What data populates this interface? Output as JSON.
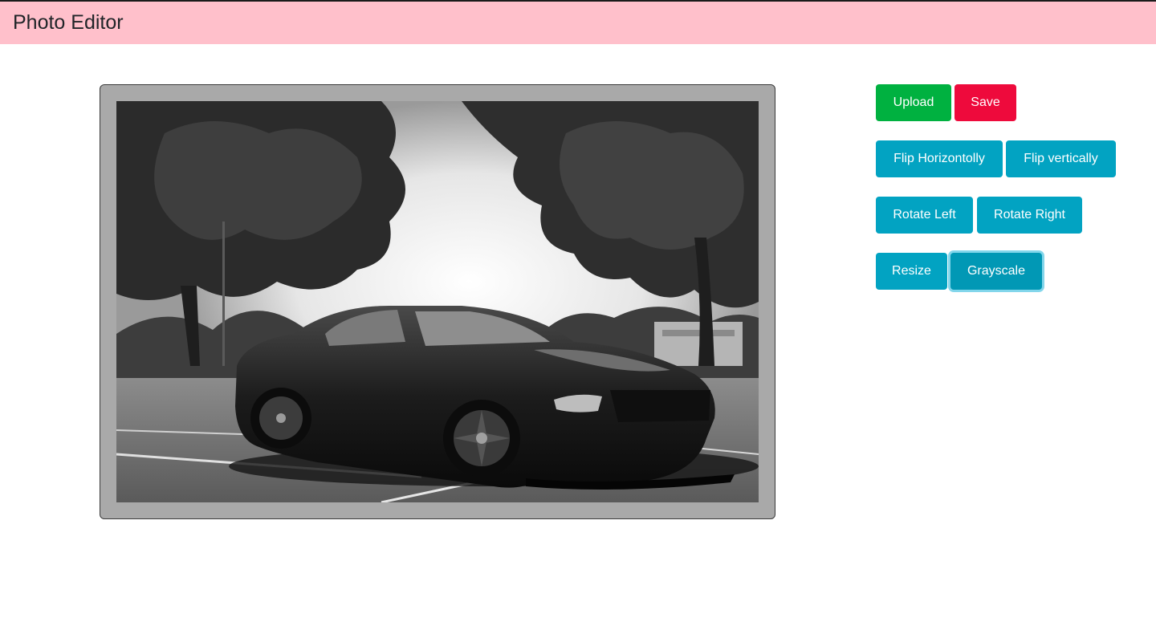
{
  "app": {
    "title": "Photo Editor",
    "navbar_color": "#ffc0cb"
  },
  "canvas": {
    "image_alt": "Grayscale photo of a black sports car parked in a lot under trees",
    "filter": "grayscale"
  },
  "toolbar": {
    "upload_label": "Upload",
    "save_label": "Save",
    "flip_horizontal_label": "Flip Horizontolly",
    "flip_vertical_label": "Flip vertically",
    "rotate_left_label": "Rotate Left",
    "rotate_right_label": "Rotate Right",
    "resize_label": "Resize",
    "grayscale_label": "Grayscale",
    "active_button": "grayscale",
    "colors": {
      "success": "#00b140",
      "danger": "#ee0a3c",
      "info": "#02a3c2"
    }
  }
}
